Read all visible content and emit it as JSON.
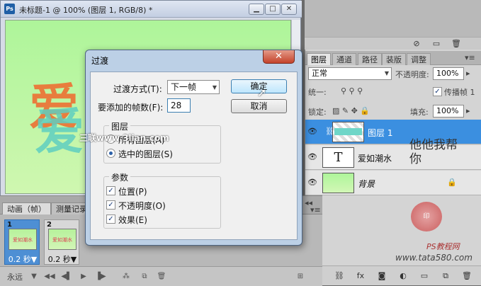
{
  "document": {
    "title": "未标题-1 @ 100% (图层 1, RGB/8) *",
    "app_icon": "Ps",
    "canvas_text": "爱",
    "buttons": {
      "minimize": "▁",
      "maximize": "□",
      "close": "✕"
    }
  },
  "layers_panel": {
    "tabs": [
      "图层",
      "通道",
      "路径",
      "装版",
      "调整"
    ],
    "active_tab": "图层",
    "blend_mode": "正常",
    "opacity_label": "不透明度:",
    "opacity_value": "100%",
    "unify_label": "统一:",
    "propagate_label": "传播帧 1",
    "propagate_checked": "✓",
    "lock_label": "锁定:",
    "fill_label": "填充:",
    "fill_value": "100%",
    "layers": [
      {
        "name": "图层 1",
        "selected": true,
        "type": "pixel"
      },
      {
        "name": "爱如潮水",
        "selected": false,
        "type": "text",
        "thumb_glyph": "T"
      },
      {
        "name": "背景",
        "selected": false,
        "type": "background",
        "lock": "🔒"
      }
    ]
  },
  "watermark": {
    "vertical_text": "他他我帮你",
    "seal_text": "印",
    "site1": "PS教程网",
    "site2": "www.tata580.com",
    "overlay": "三联www.3lian.com"
  },
  "animation_panel": {
    "tabs": [
      "动画（帧）",
      "测量记录"
    ],
    "frames": [
      {
        "number": "1",
        "delay": "0.2 秒▼",
        "selected": true,
        "thumb_text": "爱如潮水"
      },
      {
        "number": "2",
        "delay": "0.2 秒▼",
        "selected": false,
        "thumb_text": "爱如潮水"
      }
    ],
    "loop": "永远"
  },
  "dialog": {
    "title": "过渡",
    "close": "✕",
    "method_label": "过渡方式(T):",
    "method_value": "下一帧",
    "frames_label": "要添加的帧数(F):",
    "frames_value": "28",
    "ok_button": "确定",
    "cancel_button": "取消",
    "layers_group": "图层",
    "all_layers": "所有图层(A)",
    "selected_layers": "选中的图层(S)",
    "params_group": "参数",
    "position": "位置(P)",
    "opacity": "不透明度(O)",
    "effects": "效果(E)",
    "check": "✓"
  }
}
